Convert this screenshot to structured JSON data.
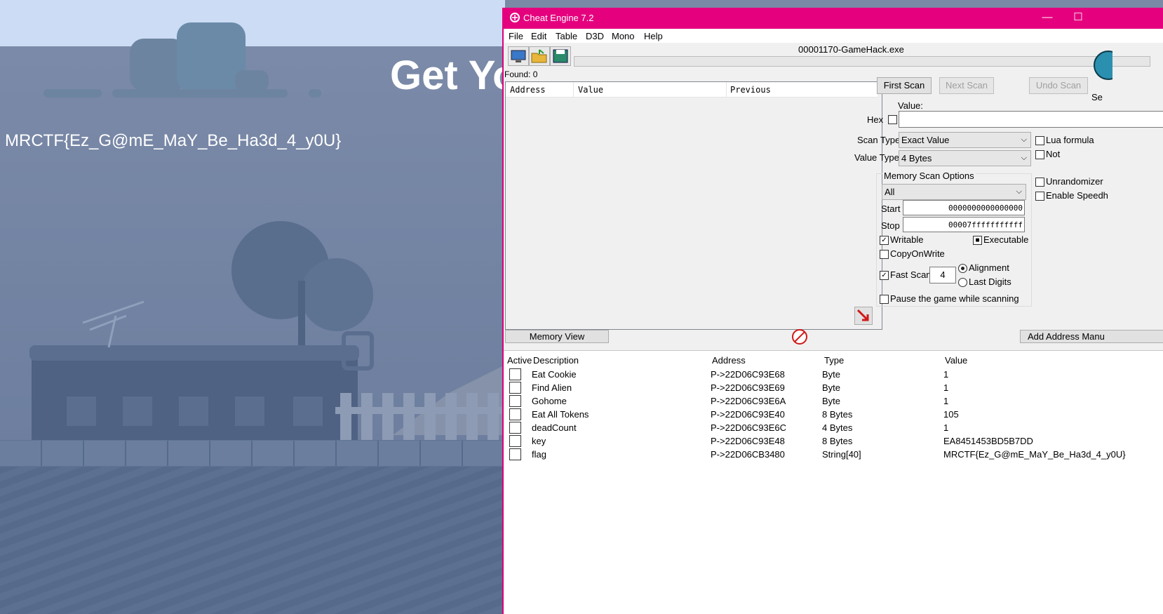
{
  "game": {
    "title_text": "Get Yo",
    "flag_text": "MRCTF{Ez_G@mE_MaY_Be_Ha3d_4_y0U}"
  },
  "window": {
    "title": "Cheat Engine 7.2",
    "minimize": "—",
    "maximize": "☐",
    "accent": "#e5007e"
  },
  "menu": [
    "File",
    "Edit",
    "Table",
    "D3D",
    "Mono",
    "Help"
  ],
  "process_name": "00001170-GameHack.exe",
  "found_label": "Found: 0",
  "scan_list": {
    "columns": [
      "Address",
      "Value",
      "Previous"
    ]
  },
  "scan_buttons": {
    "first": "First Scan",
    "next": "Next Scan",
    "undo": "Undo Scan"
  },
  "value_label": "Value:",
  "hex_label": "Hex",
  "value_input": "",
  "scan_type": {
    "label": "Scan Type",
    "value": "Exact Value"
  },
  "value_type": {
    "label": "Value Type",
    "value": "4 Bytes"
  },
  "right_options": {
    "lua": "Lua formula",
    "not": "Not",
    "unrandomizer": "Unrandomizer",
    "speedhack": "Enable Speedh"
  },
  "memory_options": {
    "title": "Memory Scan Options",
    "region": "All",
    "start_label": "Start",
    "start_value": "0000000000000000",
    "stop_label": "Stop",
    "stop_value": "00007fffffffffff",
    "writable": "Writable",
    "executable": "Executable",
    "copyonwrite": "CopyOnWrite",
    "fastscan": "Fast Scan",
    "fastscan_value": "4",
    "alignment": "Alignment",
    "lastdigits": "Last Digits",
    "pause": "Pause the game while scanning"
  },
  "settings_fragment": "Se",
  "memory_view_button": "Memory View",
  "add_address_button": "Add Address Manu",
  "address_table": {
    "columns": [
      "Active",
      "Description",
      "Address",
      "Type",
      "Value"
    ],
    "rows": [
      {
        "description": "Eat Cookie",
        "address": "P->22D06C93E68",
        "type": "Byte",
        "value": "1"
      },
      {
        "description": "Find Alien",
        "address": "P->22D06C93E69",
        "type": "Byte",
        "value": "1"
      },
      {
        "description": "Gohome",
        "address": "P->22D06C93E6A",
        "type": "Byte",
        "value": "1"
      },
      {
        "description": "Eat All Tokens",
        "address": "P->22D06C93E40",
        "type": "8 Bytes",
        "value": "105"
      },
      {
        "description": "deadCount",
        "address": "P->22D06C93E6C",
        "type": "4 Bytes",
        "value": "1"
      },
      {
        "description": "key",
        "address": "P->22D06C93E48",
        "type": "8 Bytes",
        "value": "EA8451453BD5B7DD"
      },
      {
        "description": "flag",
        "address": "P->22D06CB3480",
        "type": "String[40]",
        "value": "MRCTF{Ez_G@mE_MaY_Be_Ha3d_4_y0U}"
      }
    ]
  }
}
